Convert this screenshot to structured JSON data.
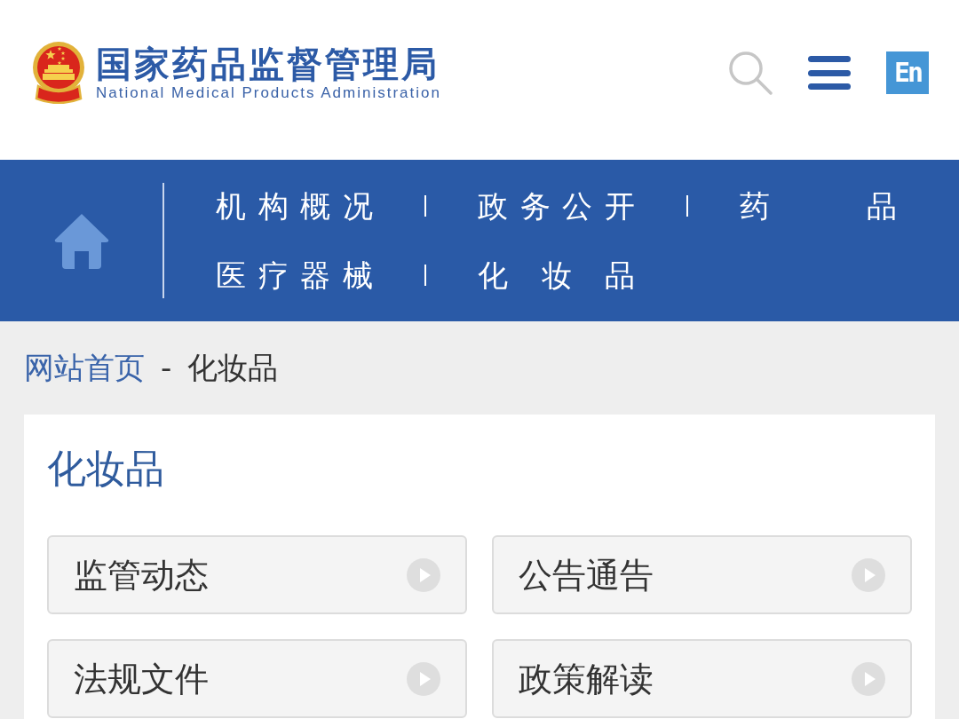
{
  "header": {
    "title": "国家药品监督管理局",
    "subtitle": "National Medical Products Administration",
    "language_button": "En"
  },
  "nav": {
    "items": [
      {
        "label": "机构概况"
      },
      {
        "label": "政务公开"
      },
      {
        "label": "药品"
      },
      {
        "label": "医疗器械"
      },
      {
        "label": "化妆品"
      }
    ]
  },
  "breadcrumb": {
    "items": [
      "网站首页",
      "化妆品"
    ],
    "separator": "-"
  },
  "section": {
    "title": "化妆品",
    "links": [
      {
        "label": "监管动态"
      },
      {
        "label": "公告通告"
      },
      {
        "label": "法规文件"
      },
      {
        "label": "政策解读"
      }
    ]
  }
}
